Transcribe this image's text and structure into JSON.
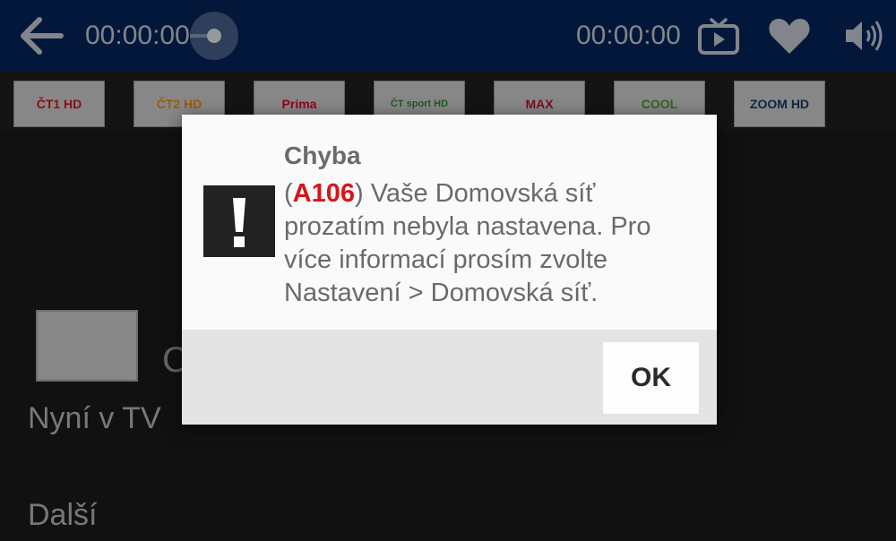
{
  "header": {
    "elapsed_time": "00:00:00",
    "total_time": "00:00:00",
    "playback_progress": 0
  },
  "channels": [
    {
      "name": "ČT1 HD",
      "color": "#d7141c"
    },
    {
      "name": "ČT2 HD",
      "color": "#f08a1c"
    },
    {
      "name": "Prima",
      "color": "#e4002b"
    },
    {
      "name": "ČT sport HD",
      "color": "#2e8b3a"
    },
    {
      "name": "MAX",
      "color": "#c8102e"
    },
    {
      "name": "COOL",
      "color": "#6cc04a"
    },
    {
      "name": "ZOOM HD",
      "color": "#1a3a6a"
    }
  ],
  "background": {
    "partial_title_letter": "C",
    "now_label": "Nyní v TV",
    "next_label": "Další"
  },
  "dialog": {
    "title": "Chyba",
    "error_code": "A106",
    "message_before": "(",
    "message_after": ") Vaše Domovská síť prozatím nebyla nastavena. Pro více informací prosím zvolte Nastavení > Domovská síť.",
    "ok_label": "OK"
  }
}
